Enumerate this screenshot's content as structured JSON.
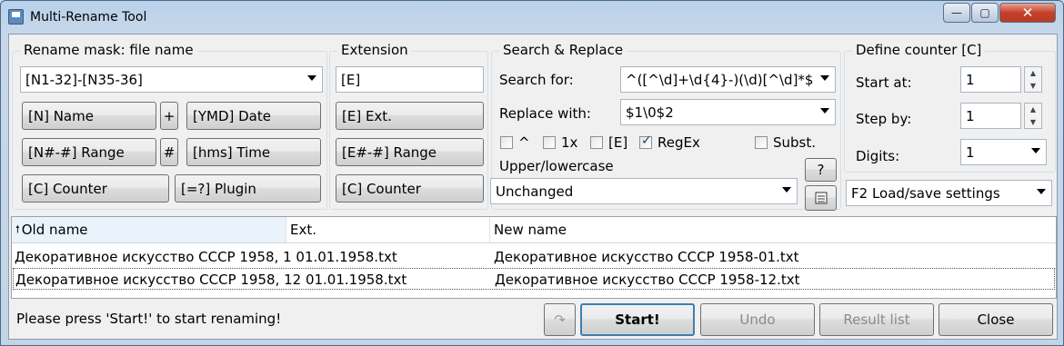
{
  "window": {
    "title": "Multi-Rename Tool",
    "min_label": "—",
    "max_label": "▢",
    "close_label": "✕"
  },
  "rename_mask": {
    "group_label": "Rename mask: file name",
    "value": "[N1-32]-[N35-36]",
    "buttons": {
      "name": "[N]  Name",
      "plus": "+",
      "date": "[YMD]  Date",
      "range": "[N#-#]  Range",
      "hash": "#",
      "time": "[hms]  Time",
      "counter": "[C]  Counter",
      "plugin": "[=?]  Plugin"
    }
  },
  "extension": {
    "group_label": "Extension",
    "value": "[E]",
    "buttons": {
      "ext": "[E]  Ext.",
      "range": "[E#-#]  Range",
      "counter": "[C]  Counter"
    }
  },
  "search_replace": {
    "group_label": "Search & Replace",
    "search_label": "Search for:",
    "search_value": "^([^\\d]+\\d{4}-)(\\d)[^\\d]*$",
    "replace_label": "Replace with:",
    "replace_value": "$1\\0$2",
    "options": [
      {
        "label": "^",
        "checked": false
      },
      {
        "label": "1x",
        "checked": false
      },
      {
        "label": "[E]",
        "checked": false
      },
      {
        "label": "RegEx",
        "checked": true
      },
      {
        "label": "Subst.",
        "checked": false
      }
    ],
    "case_label": "Upper/lowercase",
    "case_value": "Unchanged",
    "help_label": "?"
  },
  "counter": {
    "group_label": "Define counter [C]",
    "start_label": "Start at:",
    "start_value": "1",
    "step_label": "Step by:",
    "step_value": "1",
    "digits_label": "Digits:",
    "digits_value": "1",
    "settings_value": "F2 Load/save settings"
  },
  "list": {
    "columns": [
      "Old name",
      "Ext.",
      "New name"
    ],
    "rows": [
      {
        "old": "Декоративное искусство СССР 1958, 1  01.01.1958.txt",
        "new": "Декоративное искусство СССР 1958-01.txt"
      },
      {
        "old": "Декоративное искусство СССР 1958, 12  01.01.1958.txt",
        "new": "Декоративное искусство СССР 1958-12.txt"
      }
    ]
  },
  "status": "Please press 'Start!' to start renaming!",
  "actions": {
    "start": "Start!",
    "undo": "Undo",
    "result": "Result list",
    "close": "Close"
  }
}
